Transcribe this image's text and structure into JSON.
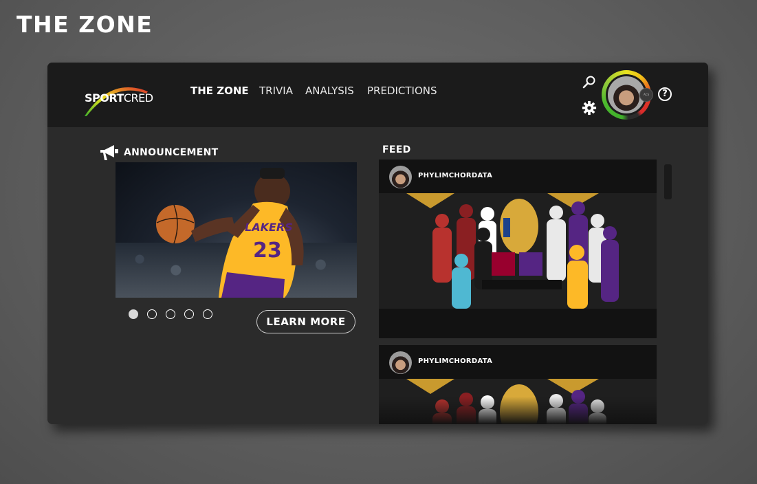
{
  "page": {
    "title": "THE ZONE"
  },
  "logo": {
    "brand_bold": "SPORT",
    "brand_light": "CRED"
  },
  "nav": {
    "items": [
      {
        "label": "THE ZONE",
        "active": true
      },
      {
        "label": "TRIVIA",
        "active": false
      },
      {
        "label": "ANALYSIS",
        "active": false
      },
      {
        "label": "PREDICTIONS",
        "active": false
      }
    ]
  },
  "header": {
    "search_icon": "search-icon",
    "settings_icon": "gear-icon",
    "help_label": "?",
    "avatar_badge": "ACS"
  },
  "announcement": {
    "heading": "ANNOUNCEMENT",
    "slide_count": 5,
    "active_slide": 1,
    "button_label": "LEARN MORE"
  },
  "feed": {
    "heading": "FEED",
    "posts": [
      {
        "username": "PHYLIMCHORDATA"
      },
      {
        "username": "PHYLIMCHORDATA"
      }
    ]
  },
  "colors": {
    "background": "#5c5c5c",
    "panel": "#2b2b2b",
    "topbar": "#1b1b1b",
    "card": "#121212",
    "accent_red": "#d92b2b",
    "accent_yellow": "#e8e21f",
    "accent_green": "#4cb82e",
    "lakers_gold": "#fdb927",
    "lakers_purple": "#552583"
  }
}
